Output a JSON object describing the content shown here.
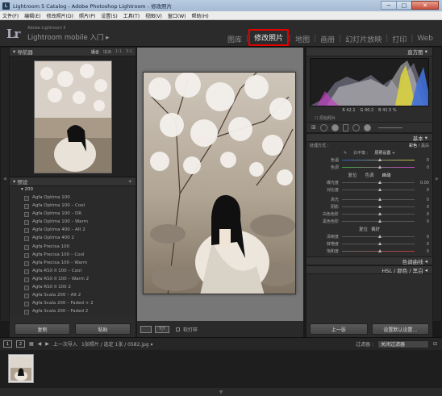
{
  "window": {
    "title": "Lightroom 5 Catalog - Adobe Photoshop Lightroom - 修改照片",
    "minimize": "─",
    "maximize": "□",
    "close": "✕"
  },
  "menu": [
    "文件(F)",
    "编辑(E)",
    "修改照片(D)",
    "照片(P)",
    "设置(S)",
    "工具(T)",
    "视图(V)",
    "窗口(W)",
    "帮助(H)"
  ],
  "brand": {
    "logo": "Lr",
    "small": "Adobe Lightroom 5",
    "mobile": "Lightroom mobile 入门 ▸"
  },
  "modules": [
    {
      "label": "图库",
      "active": false
    },
    {
      "label": "修改照片",
      "active": true
    },
    {
      "label": "地图",
      "active": false
    },
    {
      "label": "画册",
      "active": false
    },
    {
      "label": "幻灯片放映",
      "active": false
    },
    {
      "label": "打印",
      "active": false
    },
    {
      "label": "Web",
      "active": false
    }
  ],
  "navigator": {
    "title": "导航器",
    "options": [
      "适合",
      "填满",
      "1:1",
      "3:1"
    ],
    "selected": "适合"
  },
  "presets": {
    "title": "预设",
    "add": "+",
    "folder": "▾ 200",
    "items": [
      "Agfa Optima 100",
      "Agfa Optima 100 – Cool",
      "Agfa Optima 100 – DR",
      "Agfa Optima 100 – Warm",
      "Agfa Optima 400 – Alt 2",
      "Agfa Optima 400 2",
      "Agfa Precisa 100",
      "Agfa Precisa 100 – Cool",
      "Agfa Precisa 100 – Warm",
      "Agfa RSX II 100 – Cool",
      "Agfa RSX II 100 – Warm 2",
      "Agfa RSX II 100 2",
      "Agfa Scala 200 – Alt 2",
      "Agfa Scala 200 – Faded + 2",
      "Agfa Scala 200 – Faded 2"
    ]
  },
  "left_buttons": {
    "copy": "复制",
    "paste": "粘贴"
  },
  "center_toolbar": {
    "yy": "Y|Y",
    "soft_proof": "软打样"
  },
  "histogram": {
    "title": "直方图",
    "r": "R  42.1",
    "g": "G  40.2",
    "b": "B  41.5  %",
    "original": "原始照片"
  },
  "basic": {
    "title": "基本",
    "treatment_label": "处理方式 :",
    "color": "彩色",
    "bw": "黑白",
    "wb_label": "白平衡 :",
    "wb_value": "原照设置 ÷",
    "temp": "色温",
    "tint": "色调",
    "tone_label": "色调",
    "auto": "自动",
    "reset": "复位",
    "exposure": "曝光度",
    "exposure_val": "0.00",
    "contrast": "对比度",
    "highlights": "高光",
    "shadows": "阴影",
    "whites": "白色色阶",
    "blacks": "黑色色阶",
    "presence": "偏好",
    "clarity": "清晰度",
    "vibrance": "鲜艳度",
    "saturation": "饱和度",
    "zero": "0"
  },
  "tone_curve": {
    "title": "色调曲线"
  },
  "hsl": {
    "title": "HSL / 颜色 / 黑白"
  },
  "right_buttons": {
    "prev": "上一张",
    "reset": "设置默认设置..."
  },
  "filmbar": {
    "screen1": "1",
    "screen2": "2",
    "prev_import": "上一次导入",
    "count": "1张照片 / 选定 1张 / 0582.jpg ▾",
    "filter_label": "过滤器 :",
    "filter_value": "关闭过滤器"
  },
  "bottom_toggle": "▼"
}
